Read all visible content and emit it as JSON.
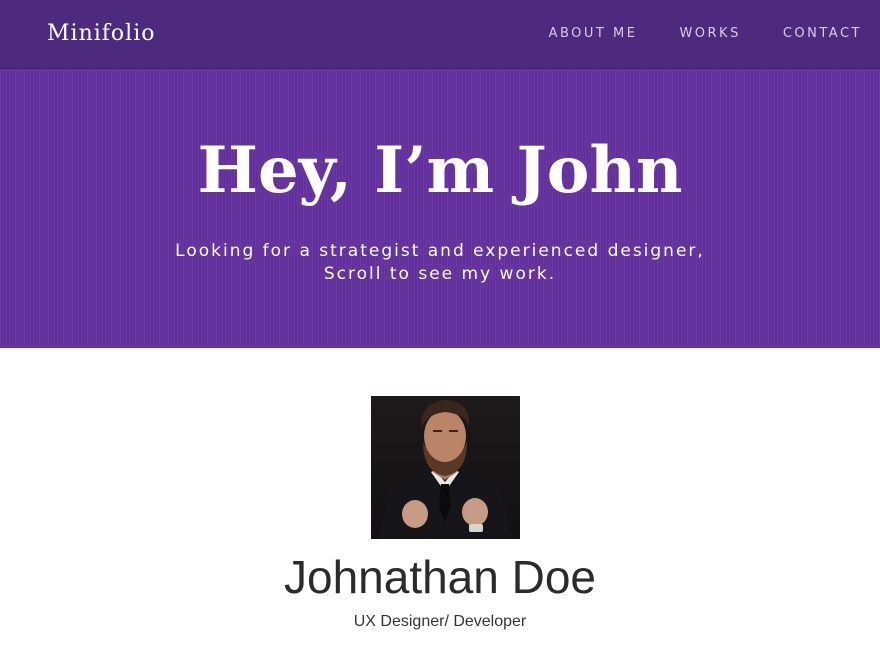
{
  "navbar": {
    "brand": "Minifolio",
    "links": [
      {
        "label": "ABOUT ME"
      },
      {
        "label": "WORKS"
      },
      {
        "label": "CONTACT"
      }
    ]
  },
  "hero": {
    "title": "Hey, I’m John",
    "subtitle_line1": "Looking for a strategist and experienced designer,",
    "subtitle_line2": "Scroll to see my work."
  },
  "profile": {
    "name": "Johnathan Doe",
    "role": "UX Designer/ Developer"
  },
  "colors": {
    "navbar": "#4e2a7e",
    "hero": "#65339f",
    "text_dark": "#2b2b2b"
  }
}
